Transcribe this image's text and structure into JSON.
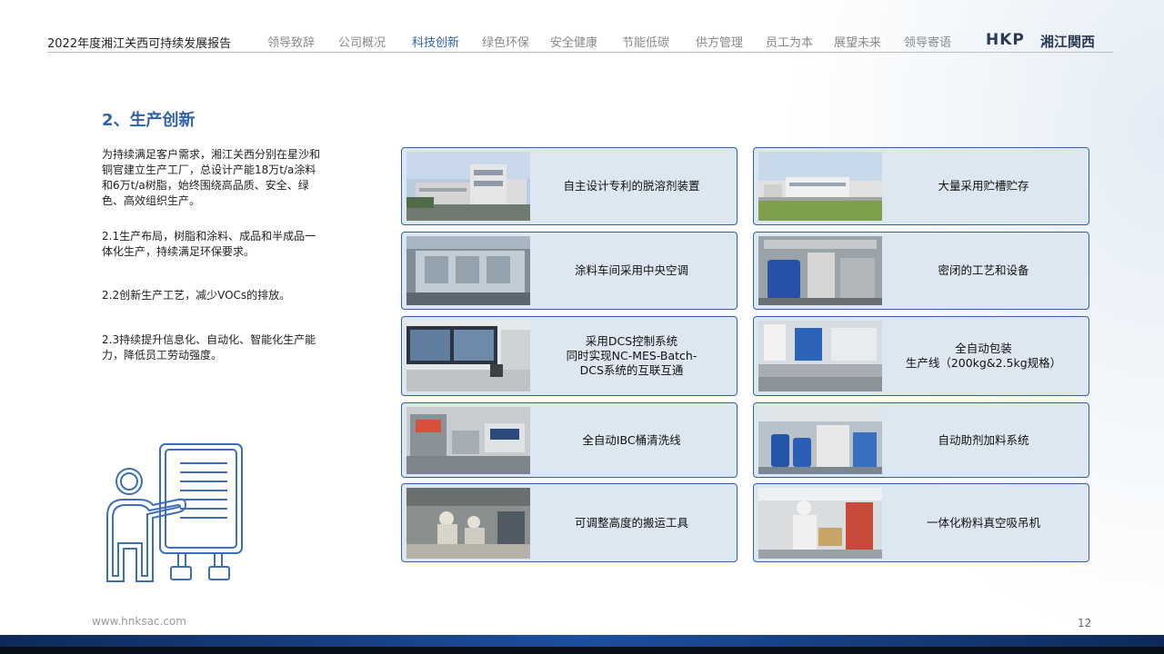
{
  "header": {
    "report_title": "2022年度湘江关西可持续发展报告",
    "nav": [
      {
        "label": "领导致辞",
        "active": false
      },
      {
        "label": "公司概况",
        "active": false
      },
      {
        "label": "科技创新",
        "active": true
      },
      {
        "label": "绿色环保",
        "active": false
      },
      {
        "label": "安全健康",
        "active": false
      },
      {
        "label": "节能低碳",
        "active": false
      },
      {
        "label": "供方管理",
        "active": false
      },
      {
        "label": "员工为本",
        "active": false
      },
      {
        "label": "展望未来",
        "active": false
      },
      {
        "label": "领导寄语",
        "active": false
      }
    ],
    "logo": {
      "mark": "HKP",
      "name": "湘江関西"
    }
  },
  "section": {
    "title": "2、生产创新",
    "paragraphs": [
      "为持续满足客户需求，湘江关西分别在星沙和铜官建立生产工厂，总设计产能18万t/a涂料和6万t/a树脂，始终围绕高品质、安全、绿色、高效组织生产。",
      "2.1生产布局，树脂和涂料、成品和半成品一体化生产，持续满足环保要求。",
      "2.2创新生产工艺，减少VOCs的排放。",
      "2.3持续提升信息化、自动化、智能化生产能力，降低员工劳动强度。"
    ]
  },
  "cards": [
    {
      "caption": "自主设计专利的脱溶剂装置",
      "photo": "factory-building-photo"
    },
    {
      "caption": "大量采用贮槽贮存",
      "photo": "storage-tank-site-photo"
    },
    {
      "caption": "涂料车间采用中央空调",
      "photo": "hvac-duct-photo"
    },
    {
      "caption": "密闭的工艺和设备",
      "photo": "closed-process-equipment-photo"
    },
    {
      "caption": "采用DCS控制系统\n同时实现NC-MES-Batch-\nDCS系统的互联互通",
      "photo": "dcs-control-room-photo"
    },
    {
      "caption": "全自动包装\n生产线（200kg&2.5kg规格）",
      "photo": "packaging-line-photo"
    },
    {
      "caption": "全自动IBC桶清洗线",
      "photo": "ibc-washing-line-photo"
    },
    {
      "caption": "自动助剂加料系统",
      "photo": "additive-dosing-photo"
    },
    {
      "caption": "可调整高度的搬运工具",
      "photo": "handling-tool-photo"
    },
    {
      "caption": "一体化粉料真空吸吊机",
      "photo": "vacuum-lifter-photo"
    }
  ],
  "footer": {
    "url": "www.hnksac.com",
    "page_number": "12"
  },
  "colors": {
    "accent": "#2f62a8",
    "card_bg": "#dde7f1",
    "footer_dark": "#0e2a5a"
  }
}
